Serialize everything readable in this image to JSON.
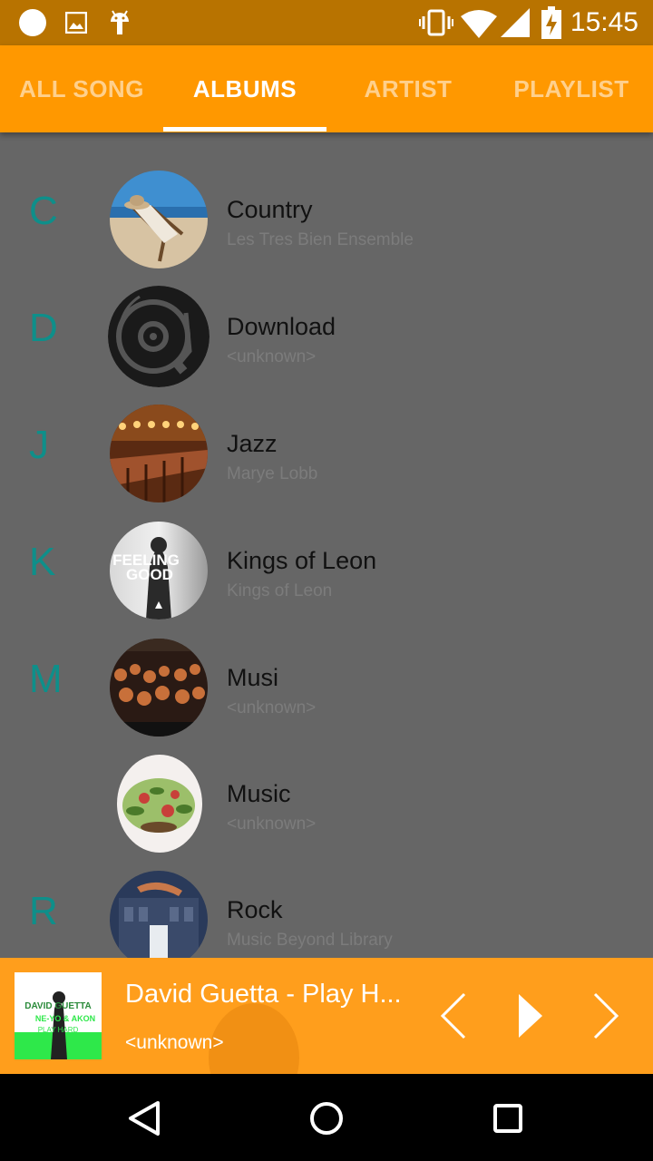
{
  "status_bar": {
    "time": "15:45"
  },
  "tabs": [
    {
      "label": "ALL SONG"
    },
    {
      "label": "ALBUMS",
      "active": true
    },
    {
      "label": "ARTIST"
    },
    {
      "label": "PLAYLIST"
    }
  ],
  "albums": [
    {
      "letter": "C",
      "title": "Country",
      "artist": "Les Tres Bien Ensemble"
    },
    {
      "letter": "D",
      "title": "Download",
      "artist": "<unknown>"
    },
    {
      "letter": "J",
      "title": "Jazz",
      "artist": "Marye Lobb"
    },
    {
      "letter": "K",
      "title": "Kings of Leon",
      "artist": "Kings of Leon"
    },
    {
      "letter": "M",
      "title": "Musi",
      "artist": "<unknown>"
    },
    {
      "letter": "",
      "title": "Music",
      "artist": "<unknown>"
    },
    {
      "letter": "R",
      "title": "Rock",
      "artist": "Music Beyond Library"
    }
  ],
  "art_text": {
    "kings_of_leon_line1": "FEELING",
    "kings_of_leon_line2": "GOOD"
  },
  "now_playing": {
    "title": "David Guetta - Play H...",
    "artist": "<unknown>",
    "cover_text_1": "DAVID GUETTA",
    "cover_text_2": "NE-YO & AKON",
    "cover_text_3": "PLAY HARD"
  },
  "colors": {
    "accent": "#ff9800",
    "status_bar": "#b87300",
    "section_letter": "#0e8f8a",
    "list_bg": "#666666"
  }
}
